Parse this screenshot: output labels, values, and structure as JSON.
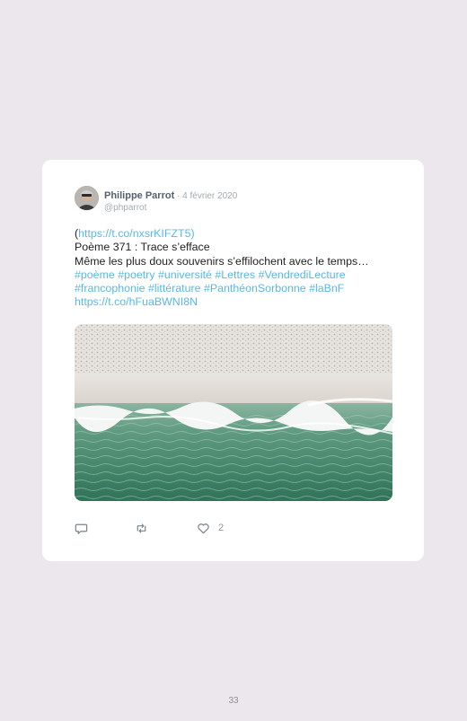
{
  "tweet": {
    "author_name": "Philippe Parrot",
    "separator": " · ",
    "date": "4 février 2020",
    "handle": "@phparrot",
    "text_line1_open": "(",
    "text_line1_link": "https://t.co/nxsrKIFZT5",
    "text_line1_close": ")",
    "text_line2": "Poème 371 : Trace s’efface",
    "text_line3": "Même les plus doux souvenirs s’effilochent avec le temps…",
    "hashtags_line1": "#poème #poetry #université #Lettres #VendrediLecture",
    "hashtags_line2": "#francophonie #littérature #PanthéonSorbonne #laBnF",
    "link_line": "https://t.co/hFuaBWNI8N",
    "image_alt": "aerial view of beach and sea waves",
    "actions": {
      "reply_icon": "reply-icon",
      "retweet_icon": "retweet-icon",
      "like_icon": "heart-icon",
      "like_count": "2"
    }
  },
  "page": {
    "number": "33"
  },
  "colors": {
    "background": "#ebe7ec",
    "link": "#58b8e6",
    "card": "#ffffff"
  }
}
